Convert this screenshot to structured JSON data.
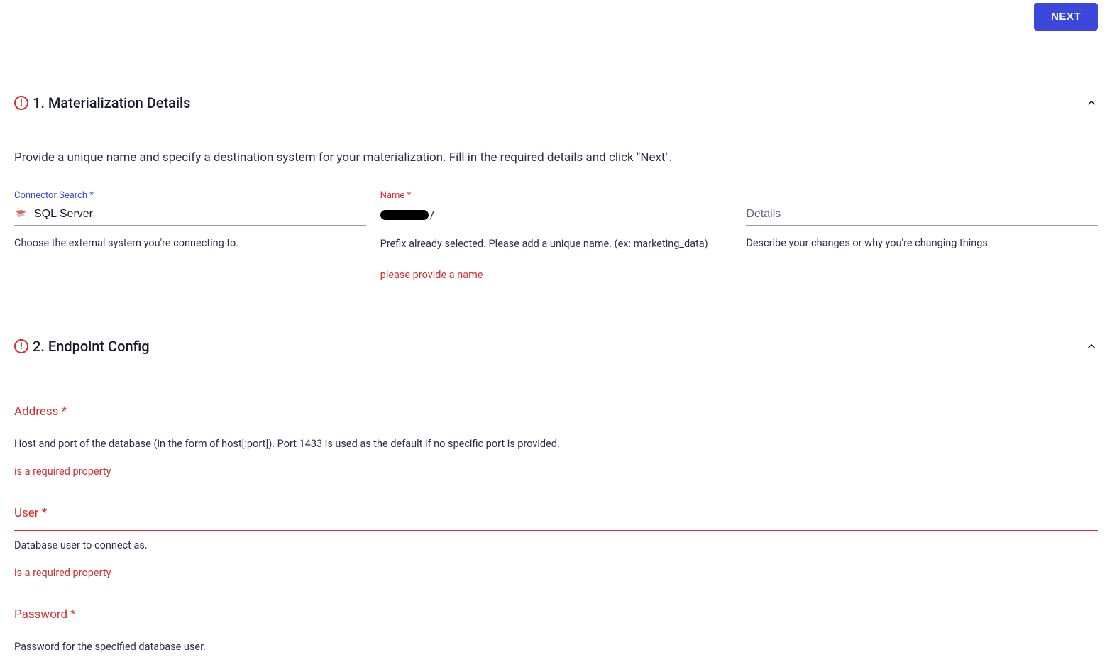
{
  "topbar": {
    "next_label": "NEXT"
  },
  "section1": {
    "title": "1. Materialization Details",
    "description": "Provide a unique name and specify a destination system for your materialization. Fill in the required details and click \"Next\".",
    "connector": {
      "label": "Connector Search *",
      "value": "SQL Server",
      "helper": "Choose the external system you're connecting to."
    },
    "name": {
      "label": "Name *",
      "prefix_slash": "/",
      "value": "",
      "helper": "Prefix already selected. Please add a unique name. (ex: marketing_data)",
      "error": "please provide a name"
    },
    "details": {
      "placeholder": "Details",
      "helper": "Describe your changes or why you're changing things."
    }
  },
  "section2": {
    "title": "2. Endpoint Config",
    "address": {
      "label": "Address *",
      "helper": "Host and port of the database (in the form of host[:port]). Port 1433 is used as the default if no specific port is provided.",
      "error": "is a required property"
    },
    "user": {
      "label": "User *",
      "helper": "Database user to connect as.",
      "error": "is a required property"
    },
    "password": {
      "label": "Password *",
      "helper": "Password for the specified database user."
    }
  }
}
